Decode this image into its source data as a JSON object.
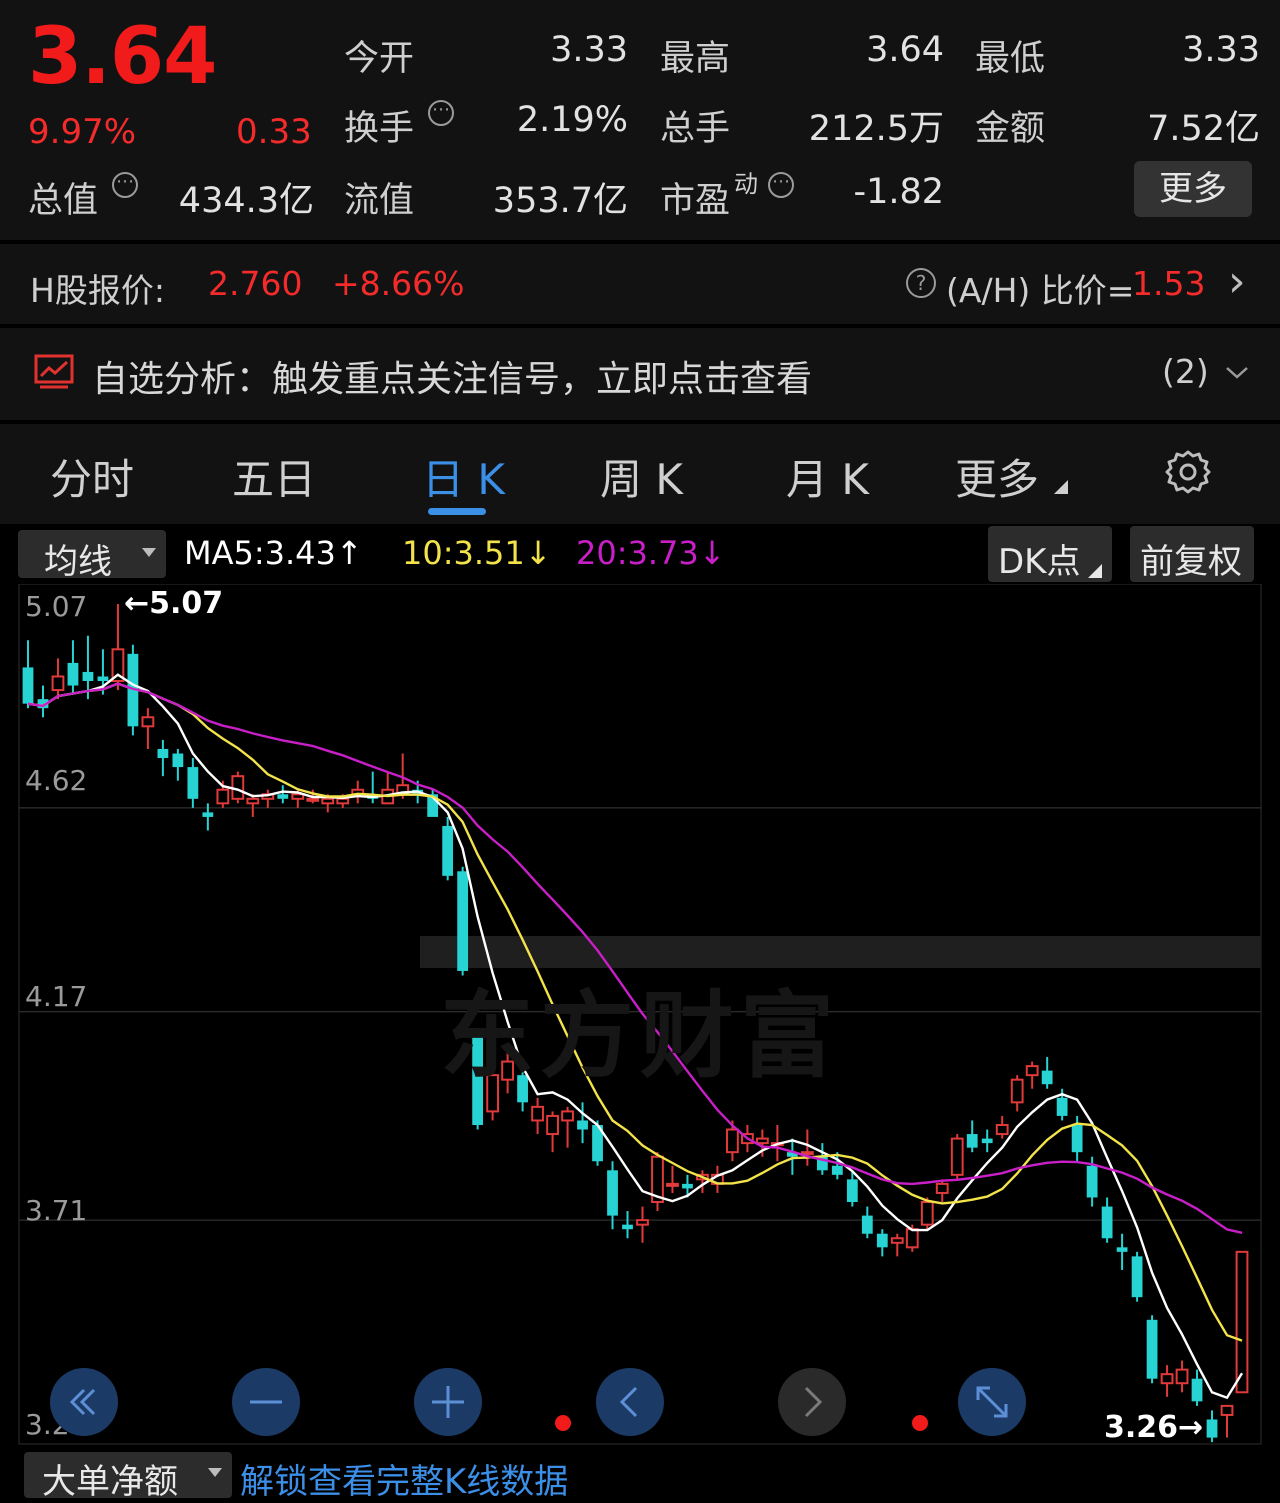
{
  "quote": {
    "price": "3.64",
    "change_pct": "9.97%",
    "change": "0.33",
    "open_label": "今开",
    "open": "3.33",
    "high_label": "最高",
    "high": "3.64",
    "low_label": "最低",
    "low": "3.33",
    "turnover_label": "换手",
    "turnover": "2.19%",
    "volume_label": "总手",
    "volume": "212.5万",
    "amount_label": "金额",
    "amount": "7.52亿",
    "mcap_label": "总值",
    "mcap": "434.3亿",
    "float_label": "流值",
    "float": "353.7亿",
    "pe_label": "市盈",
    "pe_sup": "动",
    "pe": "-1.82",
    "more_label": "更多",
    "info_glyph": "⋯"
  },
  "hshare": {
    "label": "H股报价:",
    "price": "2.760",
    "change": "+8.66%",
    "help": "?",
    "ratio_label": "(A/H) 比价=",
    "ratio": "1.53",
    "arrow": "›"
  },
  "alert": {
    "text": "自选分析：触发重点关注信号，立即点击查看",
    "count": "(2)",
    "chevron": "⌄"
  },
  "tabs": [
    {
      "label": "分时"
    },
    {
      "label": "五日"
    },
    {
      "label": "日 K"
    },
    {
      "label": "周 K"
    },
    {
      "label": "月 K"
    },
    {
      "label": "更多"
    }
  ],
  "toolbar": {
    "ma_select": "均线",
    "ma5": "MA5:3.43↑",
    "ma10": "10:3.51↓",
    "ma20": "20:3.73↓",
    "dk": "DK点",
    "adjust": "前复权"
  },
  "colors": {
    "up": "#e03a3a",
    "down": "#27d3d3",
    "ma5": "#ffffff",
    "ma10": "#f2e34a",
    "ma20": "#c81fc8",
    "accent": "#3b8fe6"
  },
  "chart_data": {
    "type": "candlestick",
    "y_ticks": [
      "5.07",
      "4.62",
      "4.17",
      "3.71",
      "3.26"
    ],
    "ylim": [
      3.26,
      5.07
    ],
    "annotations": [
      {
        "text": "←5.07"
      },
      {
        "text": "3.26→"
      }
    ],
    "watermark": "东方财富",
    "ohlc": [
      [
        4.93,
        4.99,
        4.84,
        4.85
      ],
      [
        4.86,
        4.89,
        4.82,
        4.84
      ],
      [
        4.88,
        4.95,
        4.86,
        4.91
      ],
      [
        4.94,
        4.99,
        4.87,
        4.89
      ],
      [
        4.92,
        5.0,
        4.86,
        4.9
      ],
      [
        4.91,
        4.97,
        4.87,
        4.9
      ],
      [
        4.9,
        5.07,
        4.88,
        4.97
      ],
      [
        4.96,
        4.98,
        4.78,
        4.8
      ],
      [
        4.8,
        4.84,
        4.75,
        4.82
      ],
      [
        4.75,
        4.77,
        4.69,
        4.73
      ],
      [
        4.74,
        4.75,
        4.68,
        4.71
      ],
      [
        4.71,
        4.73,
        4.62,
        4.64
      ],
      [
        4.61,
        4.63,
        4.57,
        4.6
      ],
      [
        4.63,
        4.68,
        4.62,
        4.66
      ],
      [
        4.64,
        4.7,
        4.63,
        4.69
      ],
      [
        4.63,
        4.65,
        4.6,
        4.64
      ],
      [
        4.64,
        4.66,
        4.62,
        4.65
      ],
      [
        4.65,
        4.67,
        4.63,
        4.64
      ],
      [
        4.64,
        4.66,
        4.62,
        4.65
      ],
      [
        4.64,
        4.66,
        4.63,
        4.64
      ],
      [
        4.63,
        4.65,
        4.61,
        4.64
      ],
      [
        4.63,
        4.65,
        4.62,
        4.64
      ],
      [
        4.65,
        4.68,
        4.63,
        4.66
      ],
      [
        4.65,
        4.7,
        4.63,
        4.64
      ],
      [
        4.63,
        4.7,
        4.63,
        4.66
      ],
      [
        4.65,
        4.74,
        4.64,
        4.67
      ],
      [
        4.66,
        4.68,
        4.63,
        4.65
      ],
      [
        4.65,
        4.66,
        4.62,
        4.6
      ],
      [
        4.58,
        4.6,
        4.46,
        4.47
      ],
      [
        4.48,
        4.49,
        4.25,
        4.26
      ],
      [
        4.12,
        4.13,
        3.91,
        3.92
      ],
      [
        3.95,
        4.04,
        3.93,
        4.03
      ],
      [
        4.02,
        4.09,
        3.99,
        4.06
      ],
      [
        4.03,
        4.04,
        3.95,
        3.97
      ],
      [
        3.93,
        3.98,
        3.9,
        3.96
      ],
      [
        3.9,
        3.95,
        3.86,
        3.94
      ],
      [
        3.93,
        3.96,
        3.87,
        3.95
      ],
      [
        3.93,
        3.97,
        3.88,
        3.91
      ],
      [
        3.92,
        3.93,
        3.83,
        3.84
      ],
      [
        3.82,
        3.84,
        3.69,
        3.72
      ],
      [
        3.7,
        3.73,
        3.67,
        3.69
      ],
      [
        3.7,
        3.74,
        3.66,
        3.71
      ],
      [
        3.75,
        3.86,
        3.73,
        3.85
      ],
      [
        3.79,
        3.83,
        3.77,
        3.79
      ],
      [
        3.79,
        3.81,
        3.76,
        3.78
      ],
      [
        3.8,
        3.82,
        3.77,
        3.81
      ],
      [
        3.79,
        3.83,
        3.77,
        3.81
      ],
      [
        3.86,
        3.93,
        3.84,
        3.91
      ],
      [
        3.88,
        3.92,
        3.86,
        3.9
      ],
      [
        3.88,
        3.91,
        3.85,
        3.89
      ],
      [
        3.88,
        3.92,
        3.84,
        3.88
      ],
      [
        3.86,
        3.89,
        3.81,
        3.85
      ],
      [
        3.86,
        3.91,
        3.83,
        3.86
      ],
      [
        3.85,
        3.88,
        3.81,
        3.82
      ],
      [
        3.83,
        3.86,
        3.8,
        3.81
      ],
      [
        3.8,
        3.82,
        3.74,
        3.75
      ],
      [
        3.72,
        3.74,
        3.67,
        3.68
      ],
      [
        3.68,
        3.69,
        3.63,
        3.65
      ],
      [
        3.66,
        3.68,
        3.63,
        3.67
      ],
      [
        3.65,
        3.7,
        3.64,
        3.69
      ],
      [
        3.7,
        3.76,
        3.69,
        3.75
      ],
      [
        3.77,
        3.8,
        3.75,
        3.79
      ],
      [
        3.81,
        3.9,
        3.8,
        3.89
      ],
      [
        3.9,
        3.93,
        3.86,
        3.87
      ],
      [
        3.89,
        3.91,
        3.86,
        3.88
      ],
      [
        3.9,
        3.94,
        3.89,
        3.92
      ],
      [
        3.97,
        4.03,
        3.95,
        4.02
      ],
      [
        4.03,
        4.06,
        4.0,
        4.05
      ],
      [
        4.04,
        4.07,
        4.0,
        4.01
      ],
      [
        3.98,
        4.0,
        3.93,
        3.94
      ],
      [
        3.92,
        3.94,
        3.84,
        3.86
      ],
      [
        3.83,
        3.85,
        3.74,
        3.76
      ],
      [
        3.74,
        3.76,
        3.66,
        3.67
      ],
      [
        3.65,
        3.68,
        3.6,
        3.64
      ],
      [
        3.63,
        3.64,
        3.53,
        3.54
      ],
      [
        3.49,
        3.5,
        3.35,
        3.36
      ],
      [
        3.35,
        3.39,
        3.32,
        3.37
      ],
      [
        3.35,
        3.4,
        3.33,
        3.38
      ],
      [
        3.36,
        3.38,
        3.3,
        3.31
      ],
      [
        3.27,
        3.29,
        3.22,
        3.23
      ],
      [
        3.28,
        3.3,
        3.23,
        3.3
      ],
      [
        3.33,
        3.64,
        3.33,
        3.64
      ]
    ]
  },
  "bottom": {
    "select": "大单净额",
    "link": "解锁查看完整K线数据"
  }
}
